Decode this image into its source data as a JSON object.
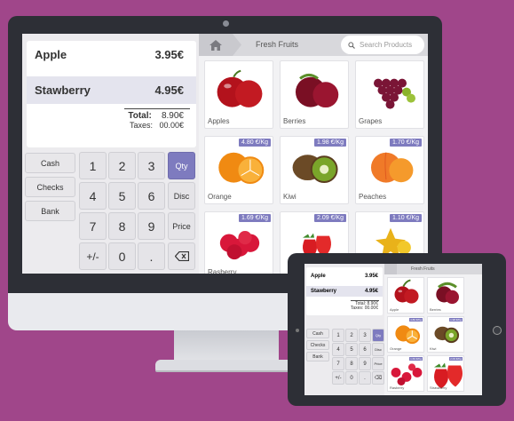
{
  "order": {
    "lines": [
      {
        "name": "Apple",
        "price": "3.95€"
      },
      {
        "name": "Stawberry",
        "price": "4.95€"
      }
    ],
    "total_label": "Total:",
    "total_value": "8.90€",
    "taxes_label": "Taxes:",
    "taxes_value": "00.00€"
  },
  "payment_methods": [
    "Cash",
    "Checks",
    "Bank"
  ],
  "numpad": {
    "keys": [
      "1",
      "2",
      "3",
      "4",
      "5",
      "6",
      "7",
      "8",
      "9",
      "+/-",
      "0",
      "."
    ],
    "modes": [
      "Qty",
      "Disc",
      "Price"
    ],
    "active_mode": "Qty",
    "backspace_icon": "backspace-icon"
  },
  "catalog": {
    "home_icon": "home-icon",
    "category": "Fresh Fruits",
    "search_placeholder": "Search Products",
    "products": [
      {
        "name": "Apples",
        "price": "",
        "icon": "apple",
        "color": "#b3121c"
      },
      {
        "name": "Berries",
        "price": "",
        "icon": "berry",
        "color": "#7a0f24"
      },
      {
        "name": "Grapes",
        "price": "",
        "icon": "grapes",
        "color": "#7a1536"
      },
      {
        "name": "Orange",
        "price": "4.80 €/Kg",
        "icon": "orange",
        "color": "#f08a12"
      },
      {
        "name": "Kiwi",
        "price": "1.98 €/Kg",
        "icon": "kiwi",
        "color": "#7aa52a"
      },
      {
        "name": "Peaches",
        "price": "1.70 €/Kg",
        "icon": "peach",
        "color": "#f07a28"
      },
      {
        "name": "Rasberry",
        "price": "1.69 €/Kg",
        "icon": "raspberry",
        "color": "#d8173a"
      },
      {
        "name": "",
        "price": "2.09 €/Kg",
        "icon": "strawberry",
        "color": "#d81c22"
      },
      {
        "name": "",
        "price": "1.10 €/Kg",
        "icon": "starfruit",
        "color": "#e9b21a"
      }
    ]
  },
  "tablet": {
    "lines": [
      {
        "name": "Apple",
        "price": "3.95€"
      },
      {
        "name": "Stawberry",
        "price": "4.95€"
      }
    ],
    "total_label": "Total:",
    "total_value": "8.90€",
    "taxes_label": "Taxes:",
    "taxes_value": "00.00€",
    "category": "Fresh Fruits",
    "payment_methods": [
      "Cash",
      "Checks",
      "Bank"
    ],
    "keys": [
      "1",
      "2",
      "3",
      "4",
      "5",
      "6",
      "7",
      "8",
      "9",
      "+/-",
      "0",
      "."
    ],
    "modes": [
      "Qty",
      "Disc",
      "Price"
    ],
    "products": [
      {
        "name": "Apple",
        "price": "",
        "color": "#b3121c"
      },
      {
        "name": "Berries",
        "price": "",
        "color": "#7a0f24"
      },
      {
        "name": "Orange",
        "price": "4.80 €/Kg",
        "color": "#f08a12"
      },
      {
        "name": "Kiwi",
        "price": "1.98 €/Kg",
        "color": "#7aa52a"
      },
      {
        "name": "Rasberry",
        "price": "1.69 €/Kg",
        "color": "#d8173a"
      },
      {
        "name": "Strawberry",
        "price": "2.09 €/Kg",
        "color": "#d81c22"
      }
    ]
  },
  "colors": {
    "background": "#a0468a",
    "accent": "#7e7bbf"
  }
}
